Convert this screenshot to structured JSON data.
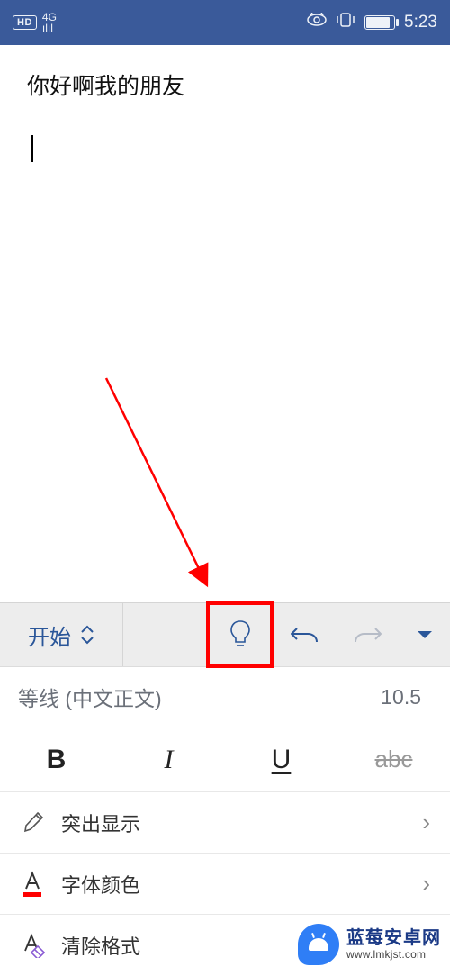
{
  "status": {
    "hd": "HD",
    "net_top": "4G",
    "time": "5:23"
  },
  "doc": {
    "text": "你好啊我的朋友"
  },
  "ribbon": {
    "tab_label": "开始",
    "icons": {
      "bulb": "lightbulb",
      "undo": "undo",
      "redo": "redo",
      "dropdown": "dropdown"
    }
  },
  "font": {
    "name": "等线 (中文正文)",
    "size": "10.5"
  },
  "styles": {
    "bold": "B",
    "italic": "I",
    "underline": "U",
    "strike": "abc"
  },
  "rows": {
    "highlight": "突出显示",
    "font_color": "字体颜色",
    "clear_format": "清除格式"
  },
  "watermark": {
    "title": "蓝莓安卓网",
    "url": "www.lmkjst.com"
  }
}
